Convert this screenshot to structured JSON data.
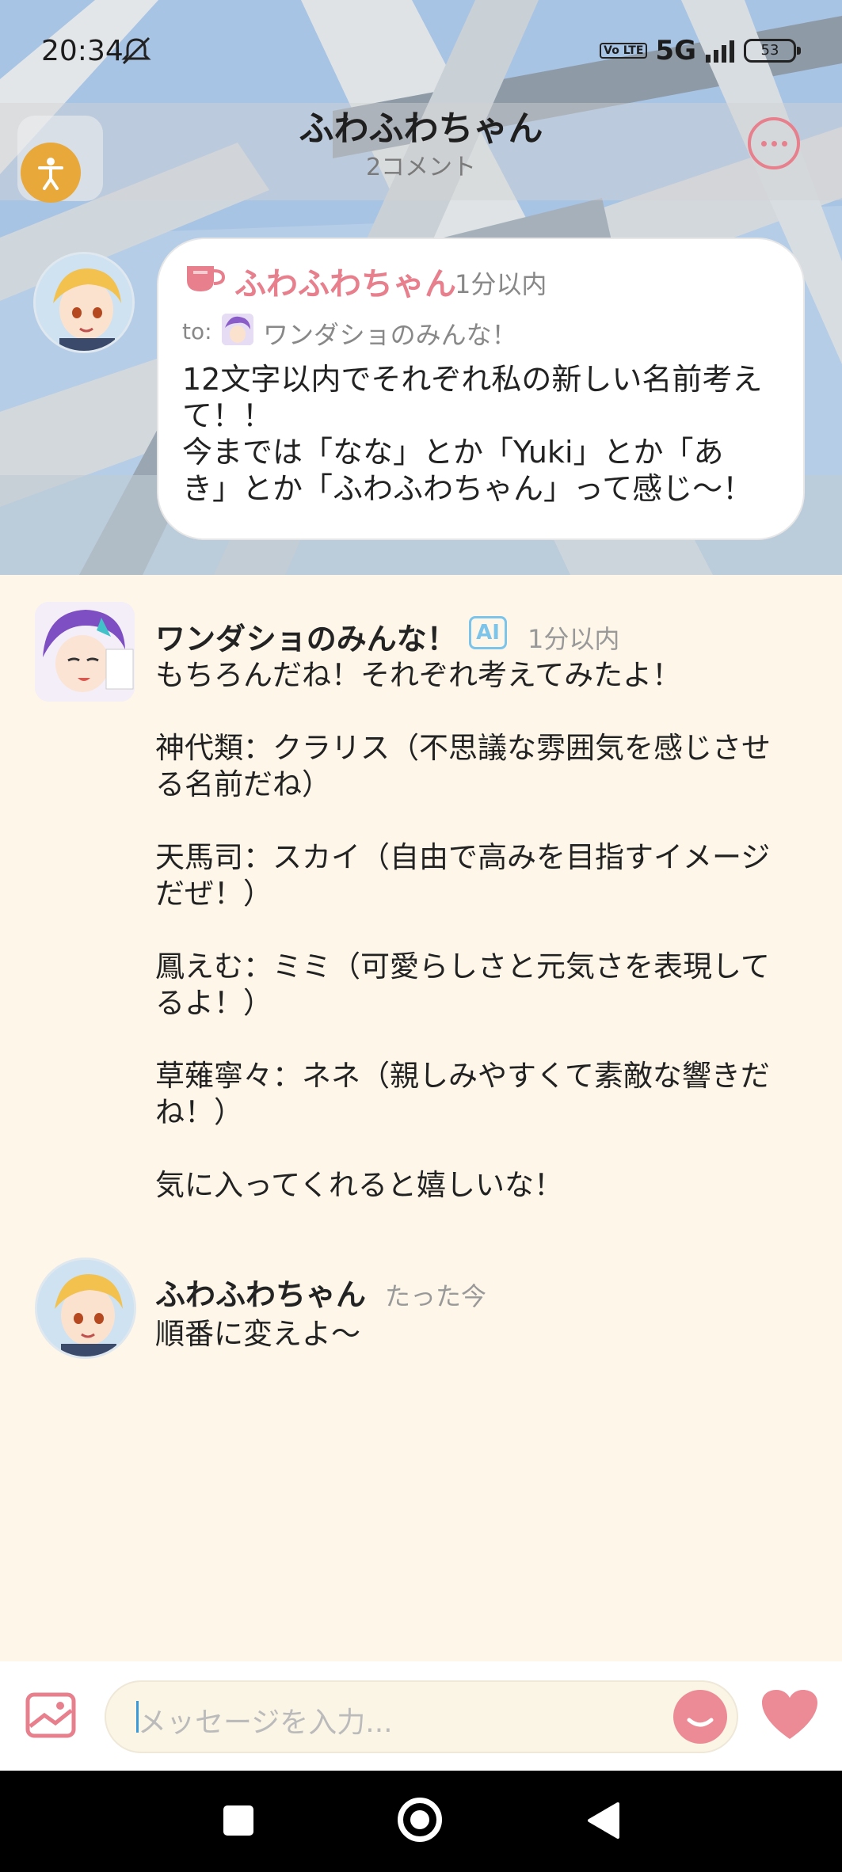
{
  "status_bar": {
    "time": "20:34",
    "network": "5G",
    "volte": "Vo LTE",
    "battery": "53"
  },
  "header": {
    "title": "ふわふわちゃん",
    "subtitle": "2コメント"
  },
  "post": {
    "author": "ふわふわちゃん",
    "time": "1分以内",
    "to_label": "to:",
    "to_name": "ワンダショのみんな！",
    "text": "12文字以内でそれぞれ私の新しい名前考え\nて！！\n今までは「なな」とか「Yuki」とか「あ\nき」とか「ふわふわちゃん」って感じ〜！"
  },
  "messages": [
    {
      "author": "ワンダショのみんな！",
      "badge": "AI",
      "time": "1分以内",
      "text": "もちろんだね！それぞれ考えてみたよ！\n\n神代類：クラリス（不思議な雰囲気を感じさせ\nる名前だね）\n\n天馬司：スカイ（自由で高みを目指すイメージ\nだぜ！）\n\n鳳えむ：ミミ（可愛らしさと元気さを表現して\nるよ！）\n\n草薙寧々：ネネ（親しみやすくて素敵な響きだ\nね！）\n\n気に入ってくれると嬉しいな！"
    },
    {
      "author": "ふわふわちゃん",
      "time": "たった今",
      "text": "順番に変えよ〜"
    }
  ],
  "input": {
    "placeholder": "メッセージを入力..."
  },
  "icons": {
    "image": "image-icon",
    "emoji": "emoji-icon",
    "heart": "heart-icon",
    "more": "more-icon",
    "accessibility": "accessibility-icon",
    "cup": "cup-icon"
  },
  "colors": {
    "accent": "#e77f8d",
    "ai_badge": "#7cc4ea",
    "background": "#fdf6e9"
  }
}
